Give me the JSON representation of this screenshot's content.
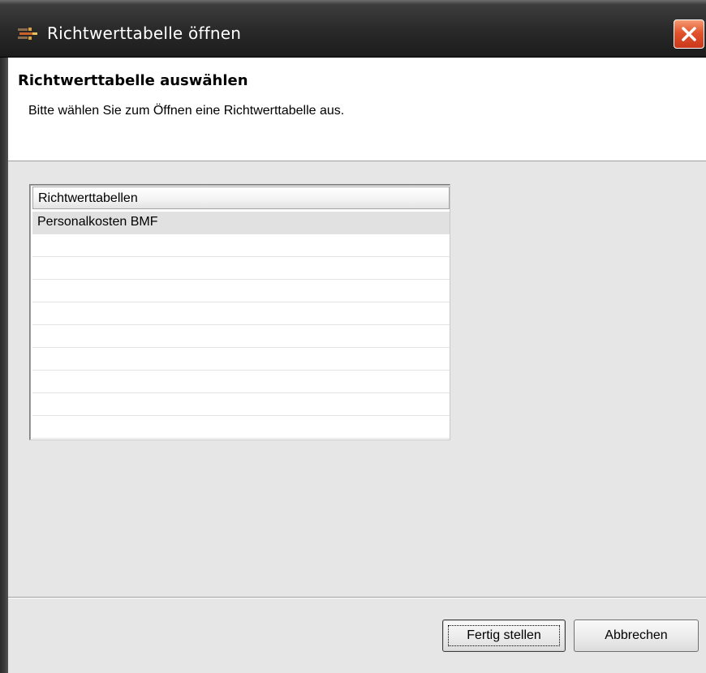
{
  "window": {
    "title": "Richtwerttabelle öffnen",
    "close_icon": "close-icon",
    "app_icon": "app-icon"
  },
  "header": {
    "title": "Richtwerttabelle auswählen",
    "description": "Bitte wählen Sie zum Öffnen eine Richtwerttabelle aus."
  },
  "table": {
    "column_header": "Richtwerttabellen",
    "rows": [
      "Personalkosten BMF",
      "",
      "",
      "",
      "",
      "",
      "",
      "",
      "",
      ""
    ],
    "selected_index": 0
  },
  "footer": {
    "finish_label": "Fertig stellen",
    "cancel_label": "Abbrechen"
  },
  "colors": {
    "close_button": "#d9472a",
    "titlebar": "#2a2a2a",
    "selection": "#e1e1e1"
  }
}
